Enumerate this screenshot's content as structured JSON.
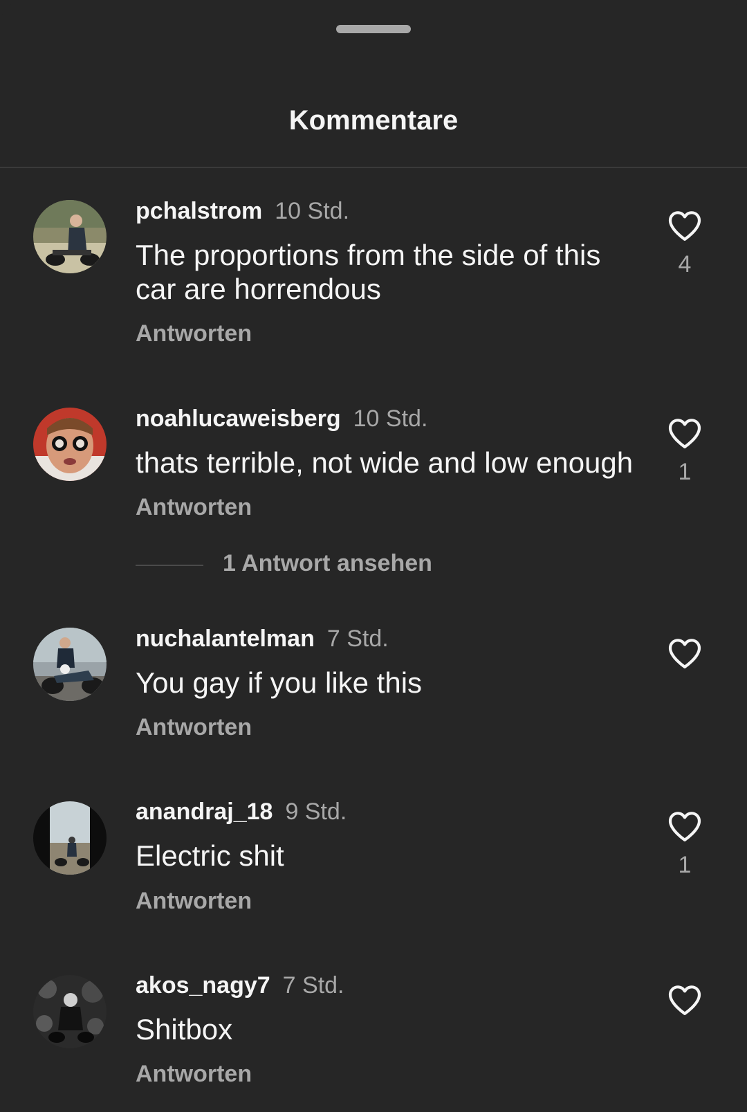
{
  "header": {
    "title": "Kommentare"
  },
  "comments": [
    {
      "username": "pchalstrom",
      "time": "10 Std.",
      "text": "The proportions from the side of this car are horrendous",
      "reply_label": "Antworten",
      "likes": "4"
    },
    {
      "username": "noahlucaweisberg",
      "time": "10 Std.",
      "text": "thats terrible, not wide and low enough",
      "reply_label": "Antworten",
      "likes": "1",
      "view_replies": "1 Antwort ansehen"
    },
    {
      "username": "nuchalantelman",
      "time": "7 Std.",
      "text": "You gay if you like this",
      "reply_label": "Antworten",
      "likes": ""
    },
    {
      "username": "anandraj_18",
      "time": "9 Std.",
      "text": "Electric shit",
      "reply_label": "Antworten",
      "likes": "1"
    },
    {
      "username": "akos_nagy7",
      "time": "7 Std.",
      "text": "Shitbox",
      "reply_label": "Antworten",
      "likes": ""
    }
  ],
  "icons": {
    "like": "heart-outline-icon",
    "handle": "drag-handle"
  },
  "colors": {
    "background": "#262626",
    "text": "#f5f5f5",
    "secondary": "#a8a8a8"
  }
}
